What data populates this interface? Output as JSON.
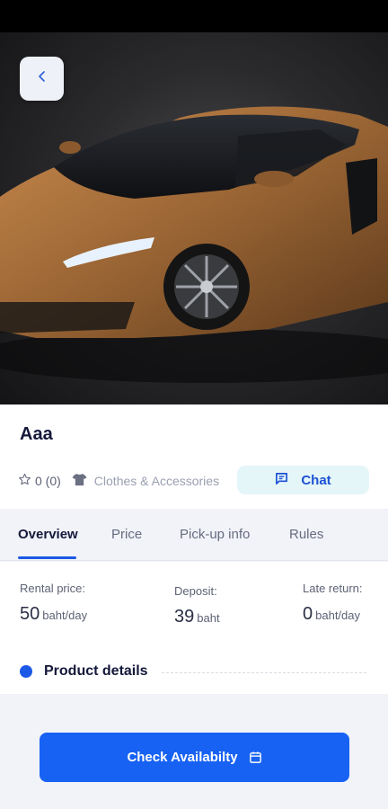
{
  "product": {
    "title": "Aaa",
    "rating": "0 (0)",
    "category": "Clothes & Accessories",
    "chat_label": "Chat"
  },
  "tabs": [
    {
      "label": "Overview",
      "active": true
    },
    {
      "label": "Price",
      "active": false
    },
    {
      "label": "Pick-up info",
      "active": false
    },
    {
      "label": "Rules",
      "active": false
    }
  ],
  "pricing": {
    "rental": {
      "label": "Rental price:",
      "value": "50",
      "unit": "baht/day"
    },
    "deposit": {
      "label": "Deposit:",
      "value": "39",
      "unit": "baht"
    },
    "late": {
      "label": "Late return:",
      "value": "0",
      "unit": "baht/day"
    }
  },
  "details": {
    "title": "Product details"
  },
  "cta": {
    "label": "Check Availabilty"
  },
  "colors": {
    "accent": "#1762f2",
    "chat_bg": "#e5f6f8",
    "car_body": "#9a6534"
  },
  "icons": [
    "chevron-left-icon",
    "star-outline-icon",
    "tshirt-icon",
    "chat-bubble-icon",
    "calendar-icon"
  ]
}
